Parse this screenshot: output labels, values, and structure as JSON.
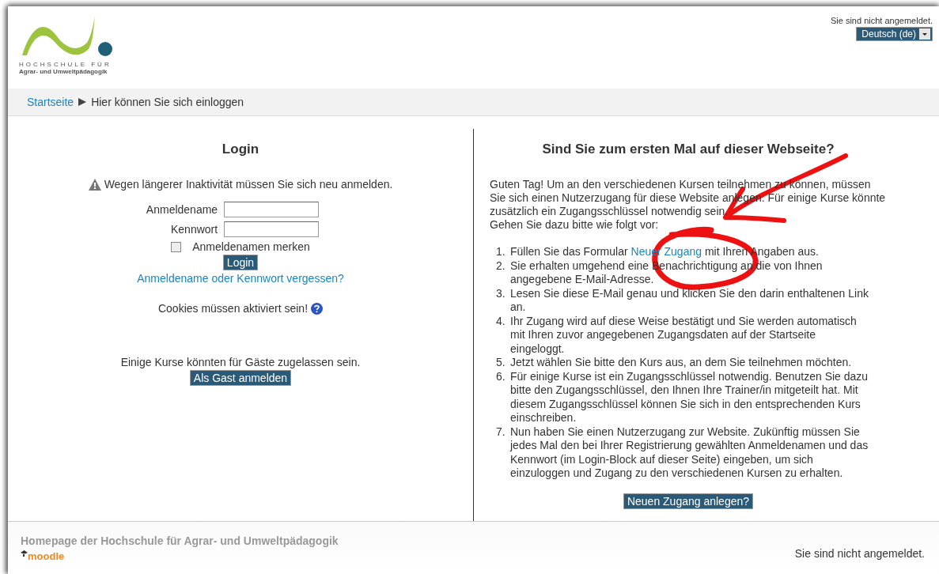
{
  "logo": {
    "line_1": "HOCHSCHULE FÜR",
    "line_2": "Agrar- und Umweltpädagogik"
  },
  "header": {
    "login_status": "Sie sind nicht angemeldet.",
    "language": "Deutsch (de)"
  },
  "breadcrumb": [
    {
      "label": "Startseite",
      "kind": "link"
    },
    {
      "label": "Hier können Sie sich einloggen",
      "kind": "current"
    }
  ],
  "login": {
    "title": "Login",
    "warning": "Wegen längerer Inaktivität müssen Sie sich neu anmelden.",
    "fields": [
      {
        "label": "Anmeldename"
      },
      {
        "label": "Kennwort"
      }
    ],
    "remember": {
      "label": "Anmeldenamen merken",
      "checked": false
    },
    "button": "Login",
    "forgot_link": "Anmeldename oder Kennwort vergessen?",
    "cookies": "Cookies müssen aktiviert sein!",
    "guest_note": "Einige Kurse könnten für Gäste zugelassen sein.",
    "guest_button": "Als Gast anmelden"
  },
  "signup": {
    "title": "Sind Sie zum ersten Mal auf dieser Webseite?",
    "intro": "Guten Tag! Um an den verschiedenen Kursen teilnehmen zu können, müssen Sie sich einen Nutzerzugang für diese Website anlegen. Für einige Kurse könnte zusätzlich ein Zugangsschlüssel notwendig sein.",
    "intro_2": "Gehen Sie dazu bitte wie folgt vor:",
    "steps": [
      {
        "number": "1.",
        "before": "Füllen Sie das Formular ",
        "link": "Neuer Zugang",
        "after": " mit Ihren Angaben aus."
      },
      {
        "number": "2.",
        "before": "Sie erhalten umgehend eine Benachrichtigung an die von Ihnen angegebene E-Mail-Adresse."
      },
      {
        "number": "3.",
        "before": "Lesen Sie diese E-Mail genau und klicken Sie den darin enthaltenen Link an."
      },
      {
        "number": "4.",
        "before": "Ihr Zugang wird auf diese Weise bestätigt und Sie werden automatisch mit Ihren zuvor angegebenen Zugangsdaten auf der Startseite eingeloggt."
      },
      {
        "number": "5.",
        "before": "Jetzt wählen Sie bitte den Kurs aus, an dem Sie teilnehmen möchten."
      },
      {
        "number": "6.",
        "before": "Für einige Kurse ist ein Zugangsschlüssel notwendig. Benutzen Sie dazu bitte den Zugangsschlüssel, den Ihnen Ihre Trainer/in mitgeteilt hat. Mit diesem Zugangsschlüssel können Sie sich in den entsprechenden Kurs einschreiben."
      },
      {
        "number": "7.",
        "before": "Nun haben Sie einen Nutzerzugang zur Website. Zukünftig müssen Sie jedes Mal den bei Ihrer Registrierung gewählten Anmeldenamen und das Kennwort (im Login-Block auf dieser Seite) eingeben, um sich einzuloggen und Zugang zu den verschiedenen Kursen zu erhalten."
      }
    ],
    "button": "Neuen Zugang anlegen?"
  },
  "footer": {
    "homepage_link": "Homepage der Hochschule für Agrar- und Umweltpädagogik",
    "brand": "moodle",
    "login_status": "Sie sind nicht angemeldet."
  }
}
